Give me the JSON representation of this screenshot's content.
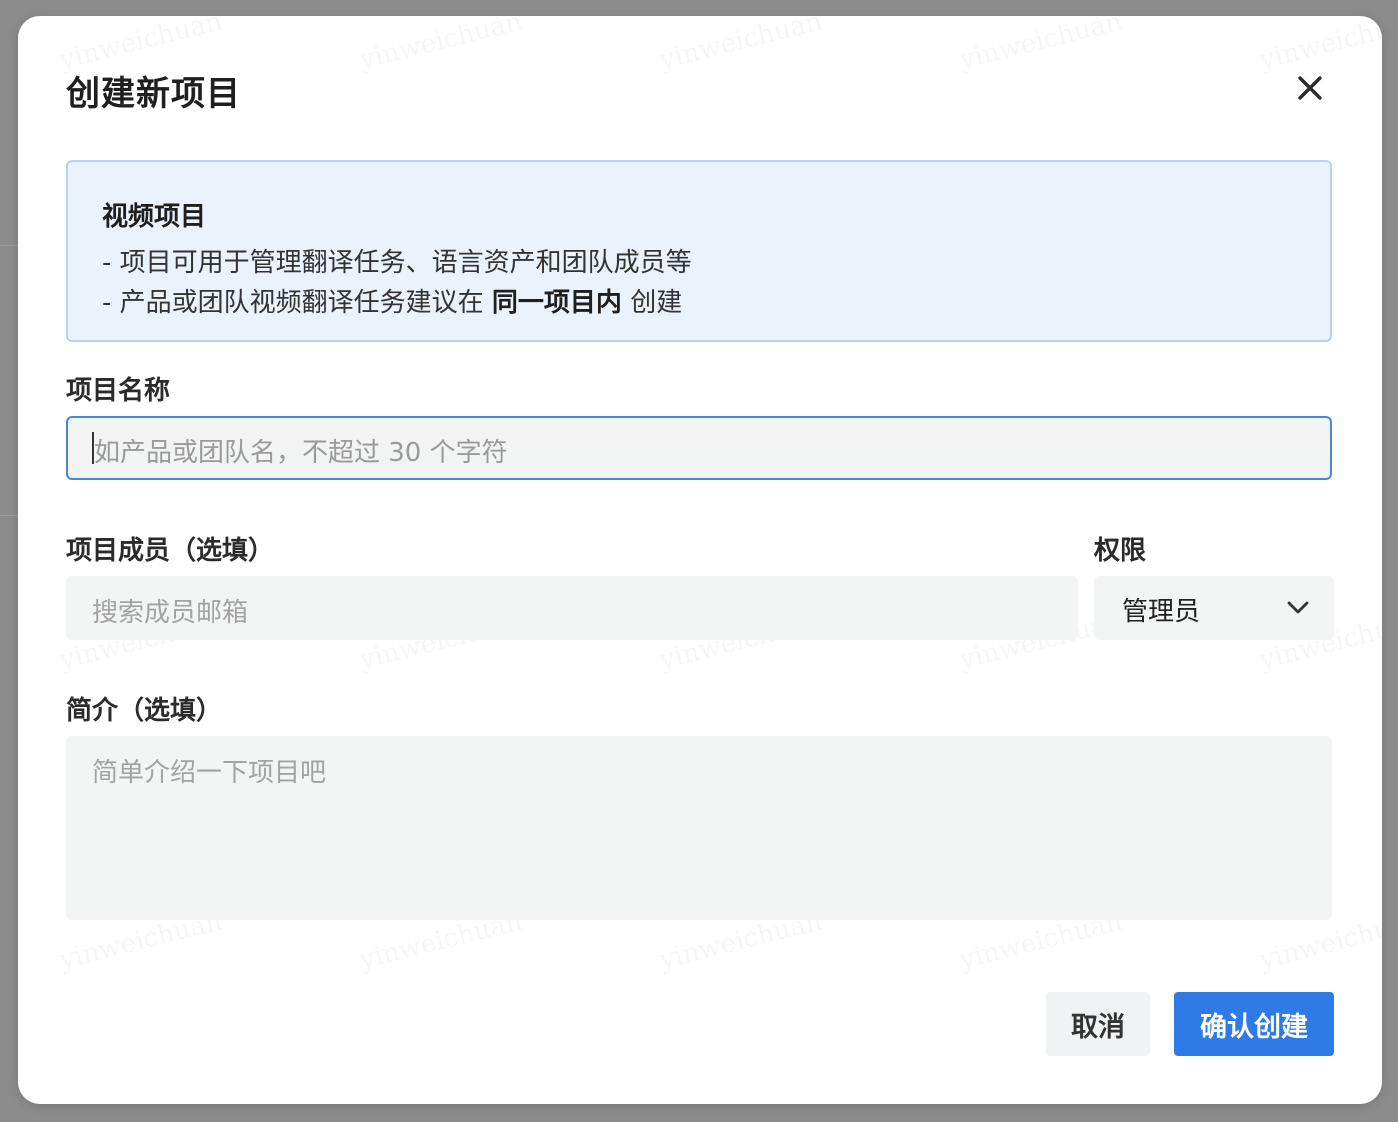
{
  "dialog": {
    "title": "创建新项目",
    "close_icon": "close-icon"
  },
  "info": {
    "title": "视频项目",
    "line1": "- 项目可用于管理翻译任务、语言资产和团队成员等",
    "line2_prefix": "- 产品或团队视频翻译任务建议在 ",
    "line2_bold": "同一项目内",
    "line2_suffix": " 创建"
  },
  "form": {
    "name_label": "项目名称",
    "name_placeholder": "如产品或团队名，不超过 30 个字符",
    "members_label": "项目成员（选填）",
    "members_placeholder": "搜索成员邮箱",
    "role_label": "权限",
    "role_value": "管理员",
    "desc_label": "简介（选填）",
    "desc_placeholder": "简单介绍一下项目吧"
  },
  "actions": {
    "cancel_label": "取消",
    "confirm_label": "确认创建"
  },
  "watermark_text": "yinweichuan",
  "colors": {
    "primary": "#2f7be6",
    "info_bg": "#eaf2fc",
    "info_border": "#b7d2f3"
  }
}
